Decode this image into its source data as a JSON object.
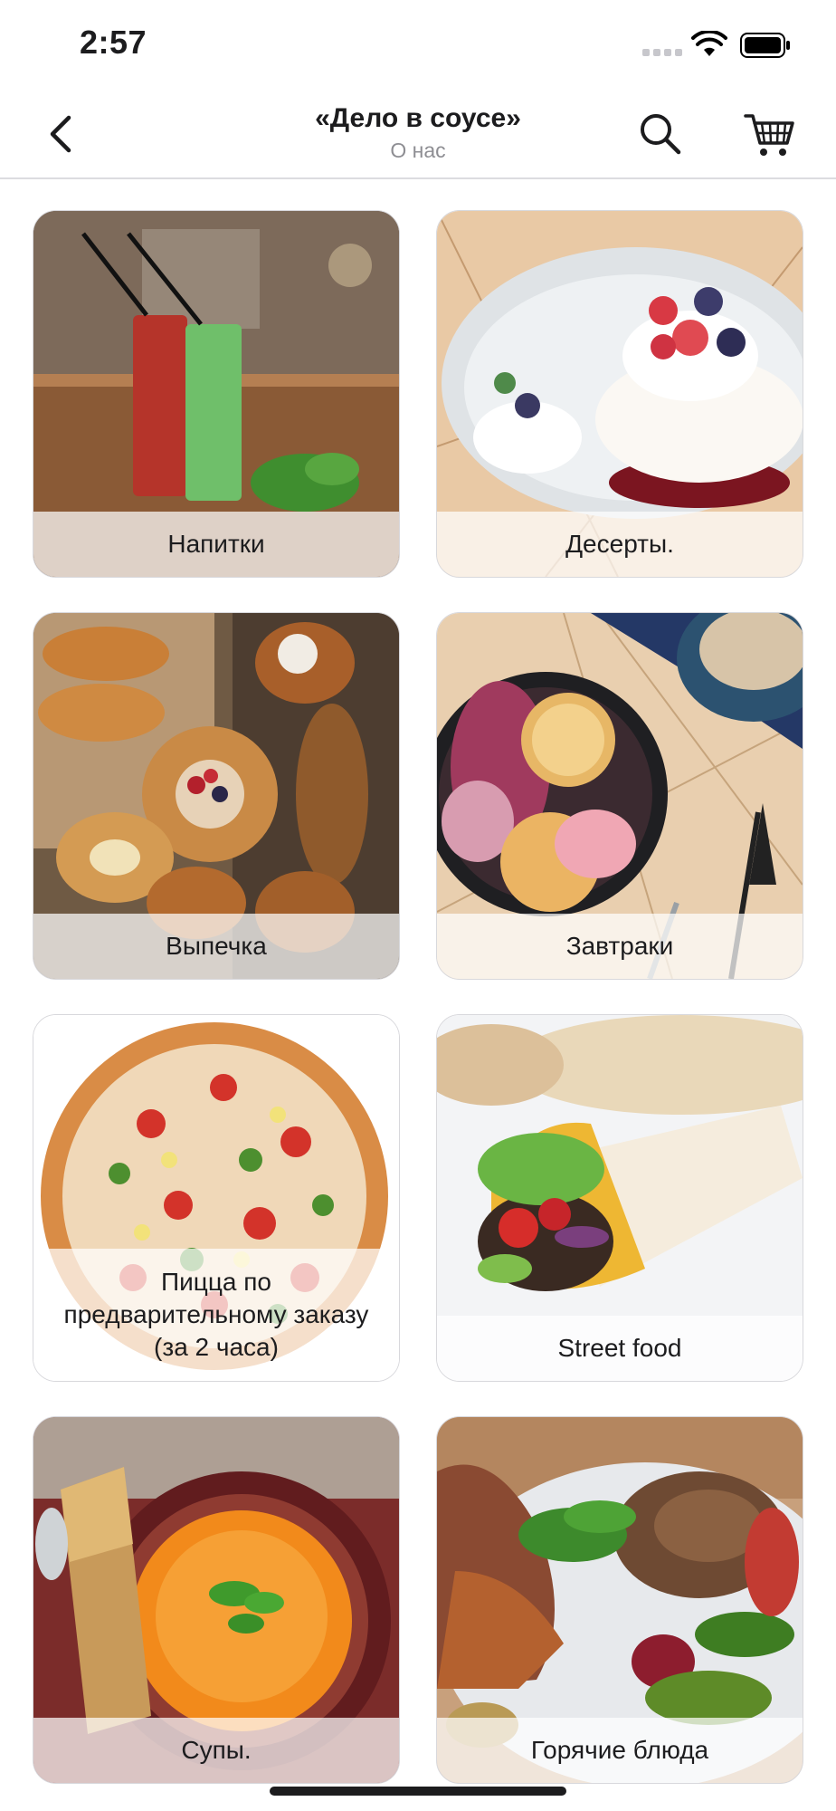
{
  "status_bar": {
    "time": "2:57"
  },
  "nav": {
    "title": "«Дело в соусе»",
    "subtitle": "О нас"
  },
  "categories": [
    {
      "label": "Напитки"
    },
    {
      "label": "Десерты."
    },
    {
      "label": "Выпечка"
    },
    {
      "label": "Завтраки"
    },
    {
      "label": "Пицца по предварительному заказу (за 2 часа)"
    },
    {
      "label": "Street food"
    },
    {
      "label": "Супы."
    },
    {
      "label": "Горячие блюда"
    }
  ],
  "icons": {
    "back": "chevron-left-icon",
    "search": "search-icon",
    "cart": "cart-icon"
  }
}
